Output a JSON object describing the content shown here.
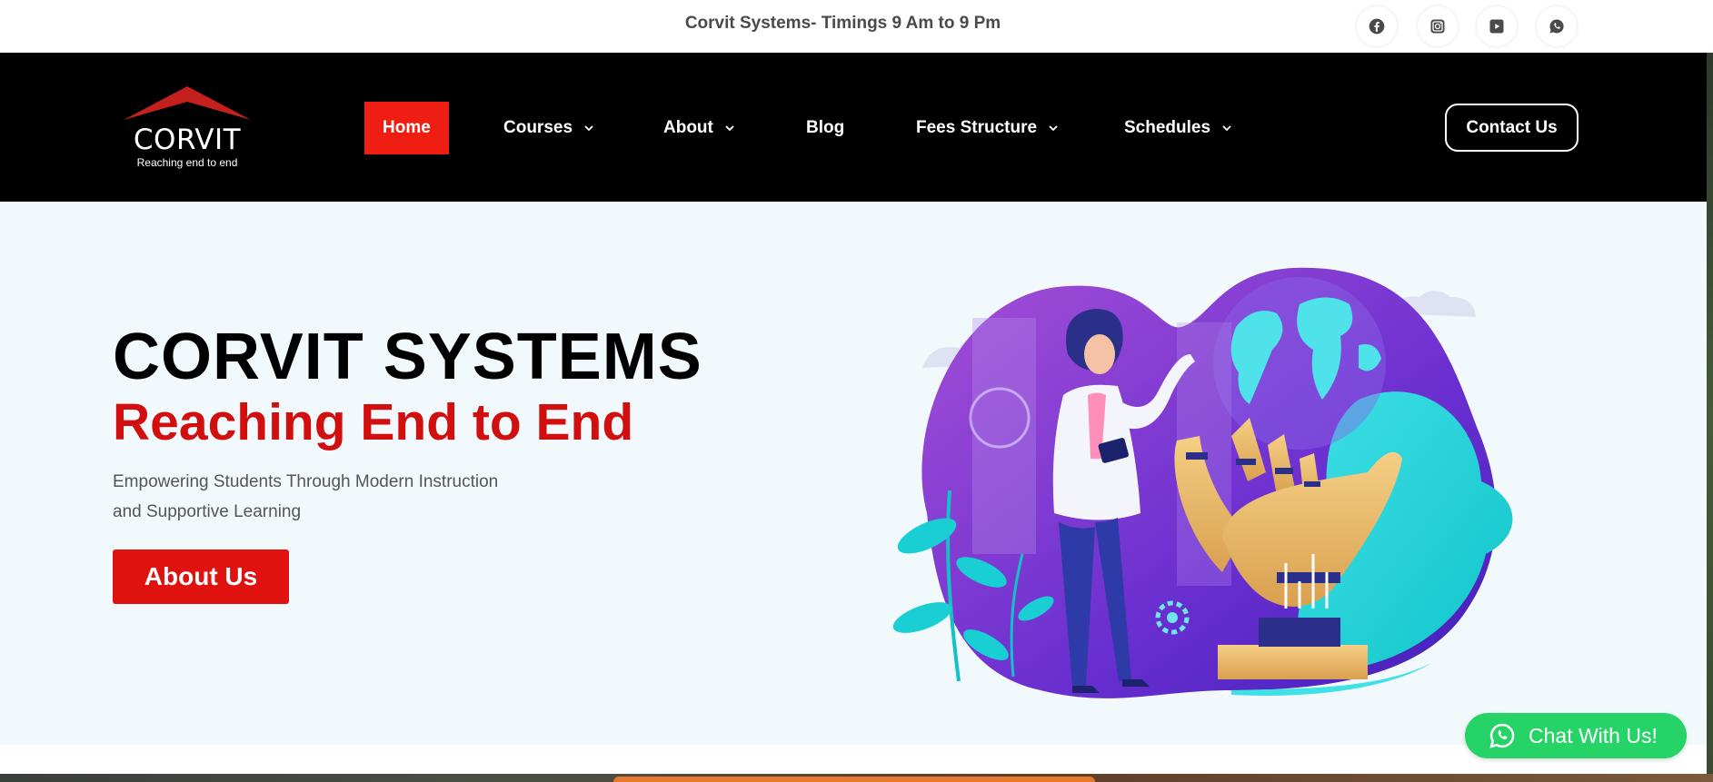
{
  "topbar": {
    "text": "Corvit Systems- Timings 9 Am to 9 Pm",
    "social": [
      {
        "name": "facebook-icon"
      },
      {
        "name": "instagram-icon"
      },
      {
        "name": "youtube-icon"
      },
      {
        "name": "whatsapp-icon"
      }
    ]
  },
  "nav": {
    "logo": {
      "name": "CORVIT",
      "tagline": "Reaching end to end"
    },
    "items": [
      {
        "label": "Home",
        "active": true,
        "dropdown": false
      },
      {
        "label": "Courses",
        "active": false,
        "dropdown": true
      },
      {
        "label": "About",
        "active": false,
        "dropdown": true
      },
      {
        "label": "Blog",
        "active": false,
        "dropdown": false
      },
      {
        "label": "Fees Structure",
        "active": false,
        "dropdown": true
      },
      {
        "label": "Schedules",
        "active": false,
        "dropdown": true
      }
    ],
    "contact_label": "Contact Us"
  },
  "hero": {
    "title": "CORVIT SYSTEMS",
    "subtitle": "Reaching End to End",
    "description_line1": "Empowering Students Through Modern Instruction",
    "description_line2": "and Supportive Learning",
    "button_label": "About Us"
  },
  "chat": {
    "label": "Chat With Us!"
  },
  "colors": {
    "accent_red": "#e0120f",
    "nav_active": "#f01e12",
    "subtitle_red": "#d20f0f",
    "nav_bg": "#000000",
    "hero_bg": "#f2f9fd",
    "whatsapp_green": "#25d366"
  }
}
